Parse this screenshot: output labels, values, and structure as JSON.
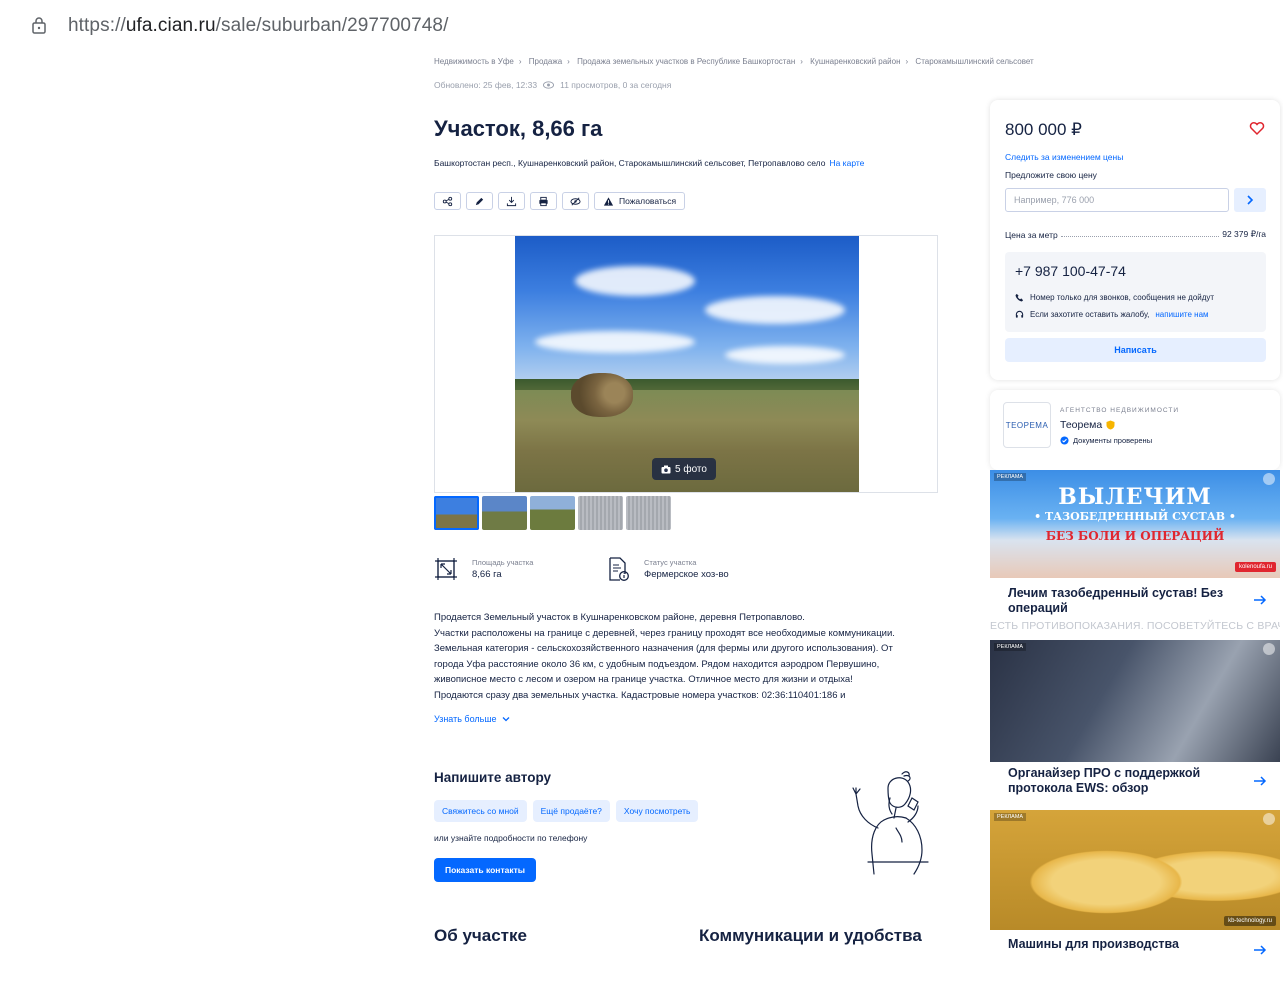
{
  "browser": {
    "url_prefix": "https://",
    "url_host": "ufa.cian.ru",
    "url_path": "/sale/suburban/297700748/"
  },
  "breadcrumbs": [
    "Недвижимость в Уфе",
    "Продажа",
    "Продажа земельных участков в Республике Башкортостан",
    "Кушнаренковский район",
    "Старокамышлинский сельсовет"
  ],
  "meta": {
    "updated": "Обновлено: 25 фев, 12:33",
    "views": "11 просмотров, 0 за сегодня"
  },
  "listing": {
    "title": "Участок, 8,66 га",
    "address": "Башкортостан респ., Кушнаренковский район, Старокамышлинский сельсовет, Петропавлово село",
    "map_link": "На карте",
    "report_label": "Пожаловаться",
    "photo_count": "5 фото",
    "facts": [
      {
        "label": "Площадь участка",
        "value": "8,66 га"
      },
      {
        "label": "Статус участка",
        "value": "Фермерское хоз-во"
      }
    ],
    "description": [
      "Продается Земельный участок в Кушнаренковском районе, деревня Петропавлово.",
      "Участки расположены на границе с деревней, через границу проходят все необходимые коммуникации.",
      "Земельная категория - сельскохозяйственного назначения (для фермы или другого использования). От",
      "города Уфа расстояние около 36 км, с удобным подъездом. Рядом находится аэродром Первушино,",
      "живописное место с лесом и озером на границе участка. Отличное место для жизни и отдыха!",
      "Продаются сразу два земельных участка. Кадастровые номера участков: 02:36:110401:186 и"
    ],
    "more_label": "Узнать больше"
  },
  "contact_author": {
    "title": "Напишите автору",
    "chips": [
      "Свяжитесь со мной",
      "Ещё продаёте?",
      "Хочу посмотреть"
    ],
    "or_phone": "или узнайте подробности по телефону",
    "show_contacts": "Показать контакты"
  },
  "sections": {
    "about": "Об участке",
    "utilities": "Коммуникации и удобства"
  },
  "price_card": {
    "price": "800 000 ₽",
    "follow": "Следить за изменением цены",
    "propose": "Предложите свою цену",
    "input_placeholder": "Например, 776 000",
    "per_meter_label": "Цена за метр",
    "per_meter_value": "92 379 ₽/га",
    "phone": "+7 987 100-47-74",
    "note_calls": "Номер только для звонков, сообщения не дойдут",
    "note_complaint": "Если захотите оставить жалобу,",
    "note_link": "напишите нам",
    "write_button": "Написать"
  },
  "agency": {
    "kind": "АГЕНТСТВО НЕДВИЖИМОСТИ",
    "name": "Теорема",
    "docs": "Документы проверены",
    "logo_text": "ТЕОРЕМА"
  },
  "ads": [
    {
      "tag": "РЕКЛАМА",
      "headline": "ВЫЛЕЧИМ",
      "sub": "• ТАЗОБЕДРЕННЫЙ СУСТАВ •",
      "red": "БЕЗ БОЛИ И ОПЕРАЦИЙ",
      "site": "kolenoufa.ru",
      "caption": "Лечим тазобедренный сустав! Без операций",
      "disclaimer": "ЕСТЬ ПРОТИВОПОКАЗАНИЯ. ПОСОВЕТУЙТЕСЬ С ВРАЧОМ"
    },
    {
      "tag": "РЕКЛАМА",
      "caption": "Органайзер ПРО с поддержкой протокола EWS: обзор"
    },
    {
      "tag": "РЕКЛАМА",
      "site": "kb-technology.ru",
      "caption": "Машины для производства"
    }
  ],
  "colors": {
    "accent": "#0468ff",
    "text": "#152242",
    "chip_bg": "#e6efff",
    "heart": "#e0262f"
  }
}
